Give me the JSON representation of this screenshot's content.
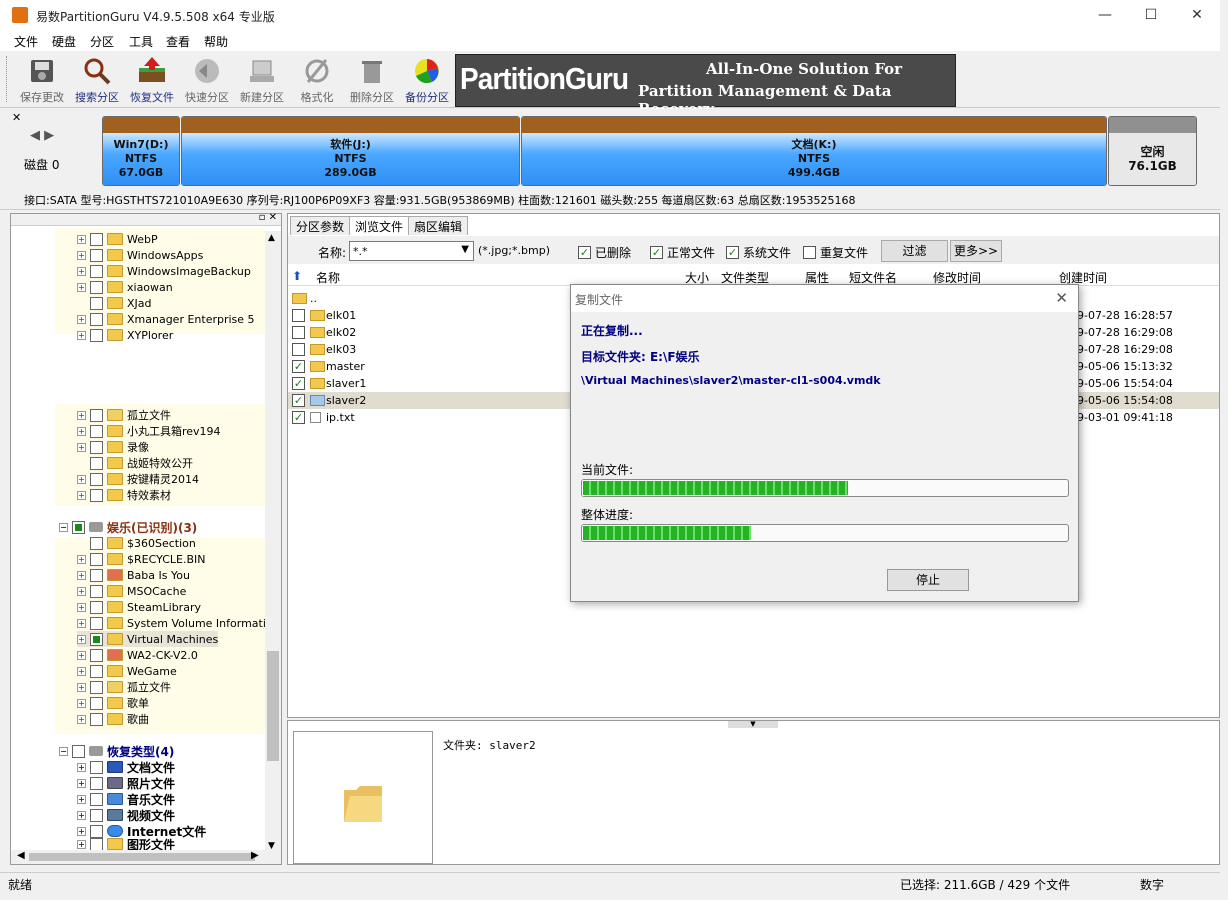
{
  "window": {
    "title": "易数PartitionGuru V4.9.5.508 x64 专业版",
    "minimize": "—",
    "maximize": "☐",
    "close": "✕"
  },
  "menu": [
    "文件",
    "硬盘",
    "分区",
    "工具",
    "查看",
    "帮助"
  ],
  "toolbar": {
    "buttons": [
      {
        "label": "保存更改",
        "icon": "save-icon",
        "enabled": false
      },
      {
        "label": "搜索分区",
        "icon": "magnifier-icon",
        "enabled": true
      },
      {
        "label": "恢复文件",
        "icon": "recover-icon",
        "enabled": true
      },
      {
        "label": "快速分区",
        "icon": "quick-partition-icon",
        "enabled": false
      },
      {
        "label": "新建分区",
        "icon": "new-partition-icon",
        "enabled": false
      },
      {
        "label": "格式化",
        "icon": "format-icon",
        "enabled": false
      },
      {
        "label": "删除分区",
        "icon": "trash-icon",
        "enabled": false
      },
      {
        "label": "备份分区",
        "icon": "backup-icon",
        "enabled": true
      }
    ]
  },
  "banner": {
    "logo": "PartitionGuru",
    "line1": "All-In-One Solution For",
    "line2": "Partition Management & Data Recovery"
  },
  "disk": {
    "label": "磁盘 0",
    "partitions": [
      {
        "name": "Win7(D:)",
        "fs": "NTFS",
        "size": "67.0GB"
      },
      {
        "name": "软件(J:)",
        "fs": "NTFS",
        "size": "289.0GB"
      },
      {
        "name": "文档(K:)",
        "fs": "NTFS",
        "size": "499.4GB"
      },
      {
        "name": "空闲",
        "fs": "",
        "size": "76.1GB"
      }
    ],
    "info": "接口:SATA  型号:HGSTHTS721010A9E630  序列号:RJ100P6P09XF3  容量:931.5GB(953869MB)  柱面数:121601  磁头数:255  每道扇区数:63  总扇区数:1953525168"
  },
  "tree": {
    "group1": [
      "WebP",
      "WindowsApps",
      "WindowsImageBackup",
      "xiaowan",
      "XJad",
      "Xmanager Enterprise 5",
      "XYPlorer"
    ],
    "group2": [
      "孤立文件",
      "小丸工具箱rev194",
      "录像",
      "战姬特效公开",
      "按键精灵2014",
      "特效素材"
    ],
    "drive_entertain": "娱乐(已识别)(3)",
    "group3": [
      "$360Section",
      "$RECYCLE.BIN",
      "Baba Is You",
      "MSOCache",
      "SteamLibrary",
      "System Volume Information",
      "Virtual Machines",
      "WA2-CK-V2.0",
      "WeGame",
      "孤立文件",
      "歌单",
      "歌曲"
    ],
    "recover_types": "恢复类型(4)",
    "group4": [
      "文档文件",
      "照片文件",
      "音乐文件",
      "视频文件",
      "Internet文件",
      "图形文件"
    ]
  },
  "tabs": [
    "分区参数",
    "浏览文件",
    "扇区编辑"
  ],
  "filter": {
    "name_label": "名称:",
    "name_value": "*.*",
    "hint": "(*.jpg;*.bmp)",
    "checks": [
      {
        "label": "已删除",
        "checked": true
      },
      {
        "label": "正常文件",
        "checked": true
      },
      {
        "label": "系统文件",
        "checked": true
      },
      {
        "label": "重复文件",
        "checked": false
      }
    ],
    "filter_button": "过滤",
    "more_button": "更多>>"
  },
  "columns": [
    "名称",
    "大小",
    "文件类型",
    "属性",
    "短文件名",
    "修改时间",
    "创建时间"
  ],
  "files": [
    {
      "name": "..",
      "created": "",
      "checked": null
    },
    {
      "name": "elk01",
      "created": "9-07-28 16:28:57",
      "checked": false
    },
    {
      "name": "elk02",
      "created": "9-07-28 16:29:08",
      "checked": false
    },
    {
      "name": "elk03",
      "created": "9-07-28 16:29:08",
      "checked": false
    },
    {
      "name": "master",
      "created": "9-05-06 15:13:32",
      "checked": true
    },
    {
      "name": "slaver1",
      "created": "9-05-06 15:54:04",
      "checked": true
    },
    {
      "name": "slaver2",
      "created": "9-05-06 15:54:08",
      "checked": true
    },
    {
      "name": "ip.txt",
      "created": "9-03-01 09:41:18",
      "checked": true
    }
  ],
  "preview": {
    "label": "文件夹: slaver2"
  },
  "status": {
    "left": "就绪",
    "selection": "已选择: 211.6GB / 429 个文件",
    "mode": "数字"
  },
  "dialog": {
    "title": "复制文件",
    "copying": "正在复制...",
    "target": "目标文件夹: E:\\F娱乐",
    "path": "\\Virtual Machines\\slaver2\\master-cl1-s004.vmdk",
    "current_label": "当前文件:",
    "current_progress": 0.55,
    "total_label": "整体进度:",
    "total_progress": 0.35,
    "stop_button": "停止"
  }
}
